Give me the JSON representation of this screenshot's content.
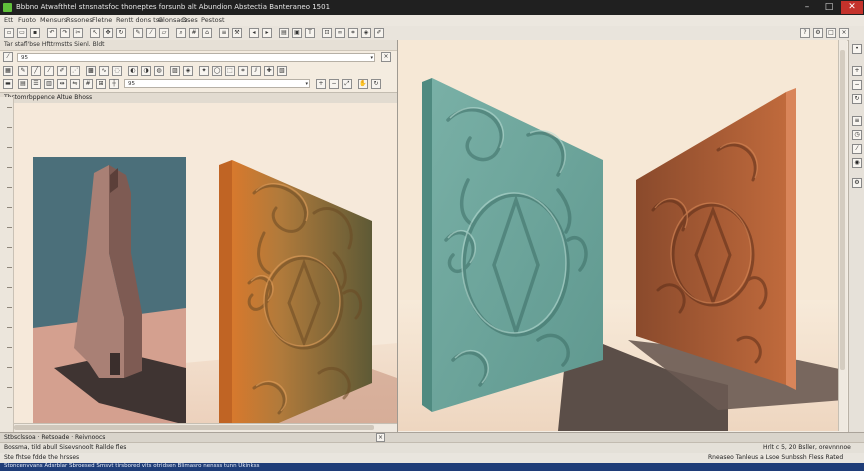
{
  "window": {
    "title": "Bbbno Atwafthtel stnsnatsfoc thoneptes forsunb alt Abundion Abstectia Banteraneo 1501",
    "minimize": "–",
    "maximize": "□",
    "close": "✕"
  },
  "menu": [
    "Ett",
    "Fuoto",
    "Mensurs",
    "Rssones",
    "Fletne",
    "Rentt dons tse",
    "Glonsacs",
    "Dses",
    "Pestost"
  ],
  "left_panel": {
    "title": "Tar stafl'bse Hfttrmstts Sienl. Bldt",
    "field_value": "95",
    "tool_field_value": "95",
    "view_title": "Thstomrbppence Altue Bhoss"
  },
  "status": {
    "left_tabs": "Stbsclssoa  ·  Retsoade  ·  Reivnoocs",
    "left_info": "Bossma, tild abull Sisevsnoolt Rallde fles",
    "right_info": "Hrlt c 5, 20 Bsller, orevnnnoe",
    "bottom_left": "Ste fhtse fdde the hrsses",
    "bottom_right": "Rneaseo Tanleus a Lsoe Sunbssh Fless Rated",
    "footer": "Stoncenvvans Adsrblar Sbroesed Smsvt tirsbored vits otridsen Blimasro nensss tunn Ukinkss"
  },
  "colors": {
    "teal_panel": "#6fa59c",
    "orange_panel": "#cf7a3a",
    "copper_panel": "#b35c35",
    "tower": "#a98075",
    "accent_blue": "#1f3d78"
  }
}
